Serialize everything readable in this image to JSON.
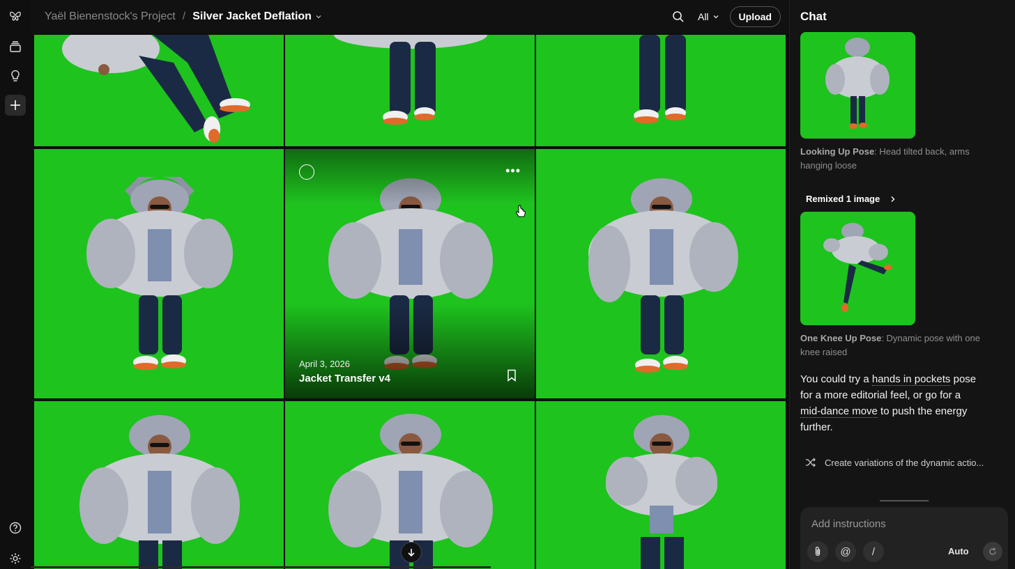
{
  "breadcrumb": {
    "project": "Yaël Bienenstock's Project",
    "separator": "/",
    "current": "Silver Jacket Deflation"
  },
  "topbar": {
    "filter_label": "All",
    "upload_label": "Upload"
  },
  "gallery": {
    "hover_tile": {
      "date": "April 3, 2026",
      "title": "Jacket Transfer v4"
    }
  },
  "chat": {
    "title": "Chat",
    "items": [
      {
        "label": "Looking Up Pose",
        "desc": ": Head tilted back, arms hanging loose"
      },
      {
        "label": "One Knee Up Pose",
        "desc": ": Dynamic pose with one knee raised"
      }
    ],
    "remix_label": "Remixed 1 image",
    "message": {
      "p1": "You could try a ",
      "l1": "hands in pockets",
      "p2": " pose for a more editorial feel, or go for a ",
      "l2": "mid-dance move",
      "p3": " to push the energy further."
    },
    "suggestion": "Create variations of the dynamic actio...",
    "composer": {
      "placeholder": "Add instructions",
      "tool_mention": "@",
      "tool_command": "/",
      "mode_label": "Auto"
    }
  },
  "colors": {
    "greenscreen": "#1ec31e",
    "background": "#0e0e0e",
    "panel": "#141414"
  }
}
